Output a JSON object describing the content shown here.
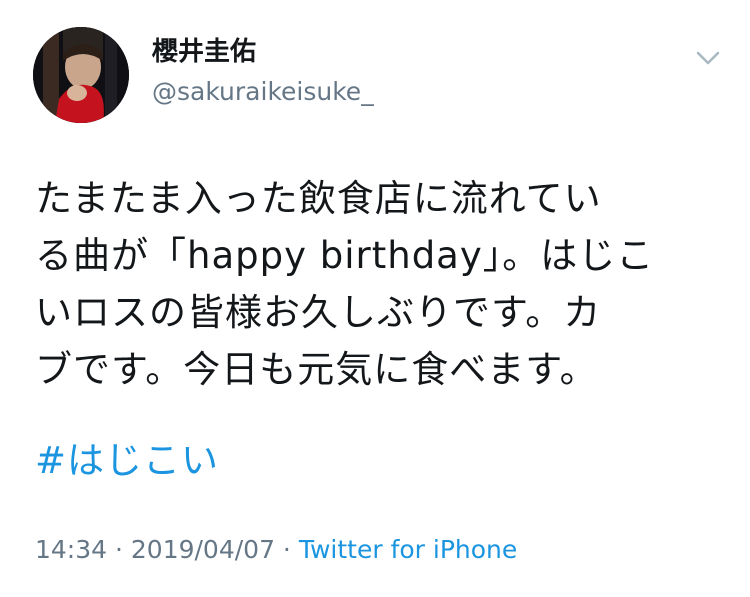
{
  "user": {
    "display_name": "櫻井圭佑",
    "handle": "@sakuraikeisuke_"
  },
  "tweet": {
    "lines": [
      "たまたま入った飲食店に流れてい",
      "る曲が「happy birthday」。はじこ",
      "いロスの皆様お久しぶりです。カ",
      "ブです。今日も元気に食べます。"
    ],
    "hashtag": "#はじこい"
  },
  "meta": {
    "time": "14:34",
    "sep1": " · ",
    "date": "2019/04/07",
    "sep2": " · ",
    "source": "Twitter for iPhone"
  },
  "icons": {
    "menu": "chevron-down-icon",
    "avatar": "profile-photo"
  },
  "colors": {
    "text": "#14171a",
    "secondary": "#657786",
    "link": "#1b95e0"
  }
}
